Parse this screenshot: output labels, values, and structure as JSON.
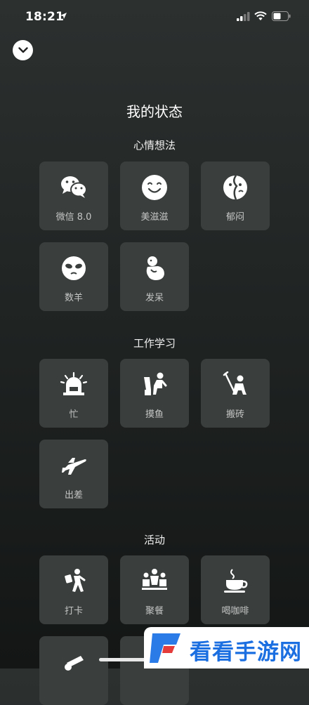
{
  "status": {
    "time": "18:21"
  },
  "page": {
    "title": "我的状态"
  },
  "sections": [
    {
      "title": "心情想法",
      "items": [
        {
          "label": "微信 8.0",
          "icon": "wechat-icon"
        },
        {
          "label": "美滋滋",
          "icon": "smile-icon"
        },
        {
          "label": "郁闷",
          "icon": "gloomy-face-icon"
        },
        {
          "label": "数羊",
          "icon": "sleepy-face-icon"
        },
        {
          "label": "发呆",
          "icon": "daze-icon"
        }
      ]
    },
    {
      "title": "工作学习",
      "items": [
        {
          "label": "忙",
          "icon": "busy-alarm-icon"
        },
        {
          "label": "摸鱼",
          "icon": "slacking-icon"
        },
        {
          "label": "搬砖",
          "icon": "laborer-icon"
        },
        {
          "label": "出差",
          "icon": "airplane-icon"
        }
      ]
    },
    {
      "title": "活动",
      "items": [
        {
          "label": "打卡",
          "icon": "checkin-icon"
        },
        {
          "label": "聚餐",
          "icon": "dinner-icon"
        },
        {
          "label": "喝咖啡",
          "icon": "coffee-icon"
        }
      ]
    }
  ],
  "watermark": {
    "text": "看看手游网"
  }
}
